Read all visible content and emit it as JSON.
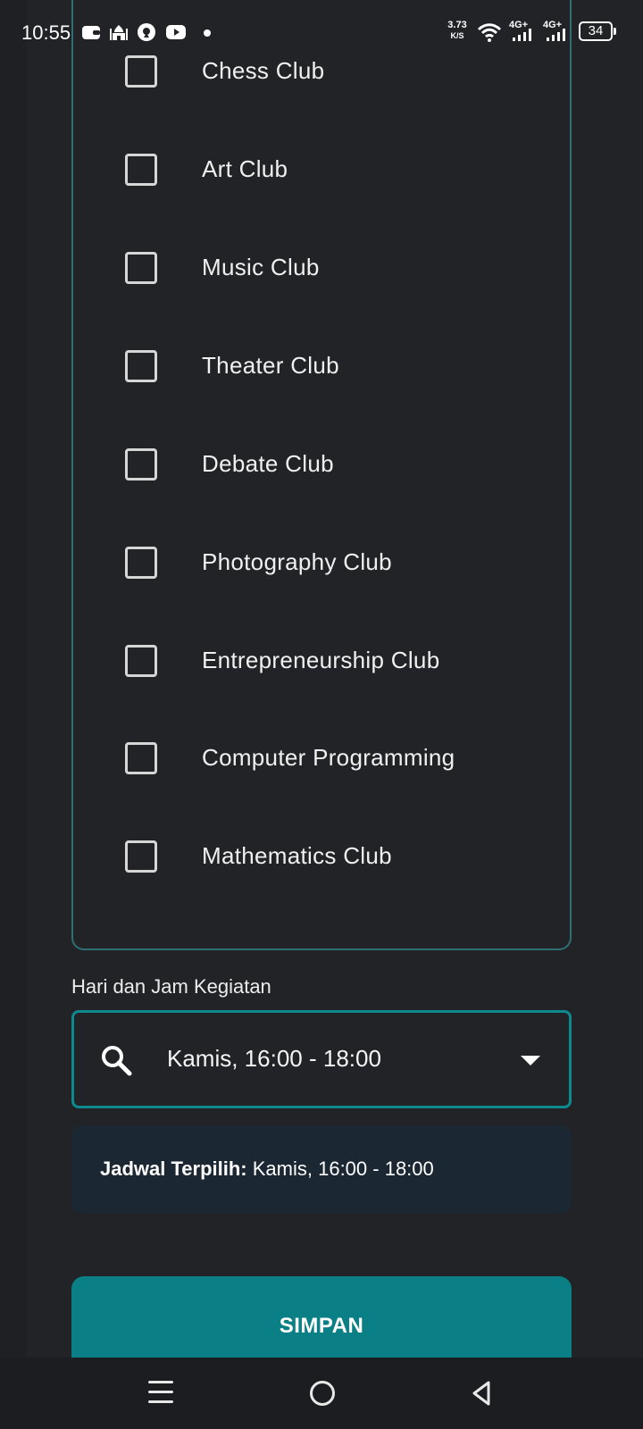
{
  "status_bar": {
    "time": "10:55",
    "network_speed_value": "3.73",
    "network_speed_unit": "K/S",
    "signal_1": "4G+",
    "signal_2": "4G+",
    "battery": "34"
  },
  "clubs": [
    {
      "label": "Chess Club",
      "checked": false
    },
    {
      "label": "Art Club",
      "checked": false
    },
    {
      "label": "Music Club",
      "checked": false
    },
    {
      "label": "Theater Club",
      "checked": false
    },
    {
      "label": "Debate Club",
      "checked": false
    },
    {
      "label": "Photography Club",
      "checked": false
    },
    {
      "label": "Entrepreneurship Club",
      "checked": false
    },
    {
      "label": "Computer Programming",
      "checked": false
    },
    {
      "label": "Mathematics Club",
      "checked": false
    }
  ],
  "schedule": {
    "label": "Hari dan Jam Kegiatan",
    "value": "Kamis, 16:00 - 18:00",
    "selected_prefix": "Jadwal Terpilih:",
    "selected_value": "Kamis, 16:00 - 18:00"
  },
  "save_label": "SIMPAN",
  "colors": {
    "background": "#222327",
    "accent": "#0b7f86",
    "card_border": "#2f6f73",
    "selected_bg": "#1b2733"
  }
}
